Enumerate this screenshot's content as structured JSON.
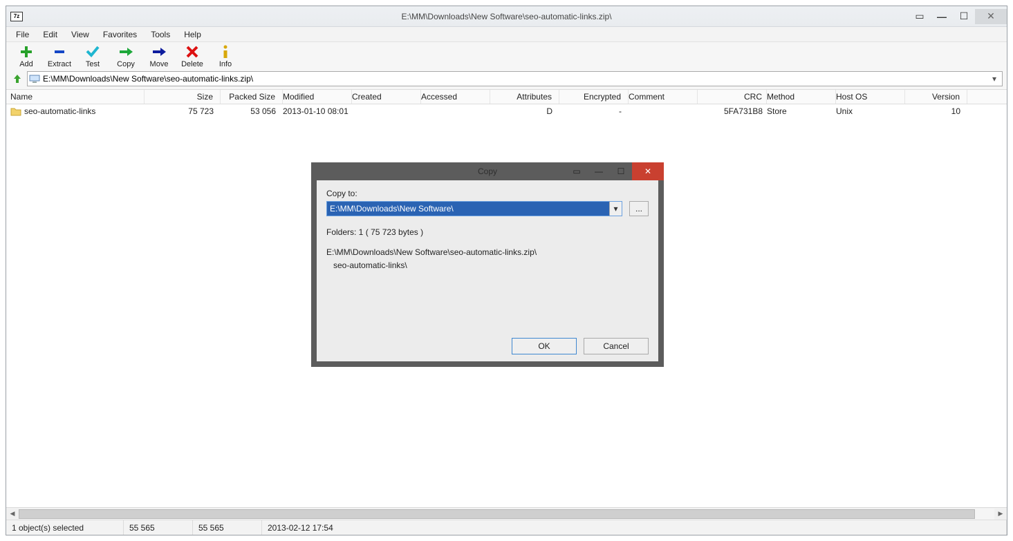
{
  "app_icon_label": "7z",
  "window_title": "E:\\MM\\Downloads\\New Software\\seo-automatic-links.zip\\",
  "menubar": [
    "File",
    "Edit",
    "View",
    "Favorites",
    "Tools",
    "Help"
  ],
  "toolbar": {
    "add": "Add",
    "extract": "Extract",
    "test": "Test",
    "copy": "Copy",
    "move": "Move",
    "delete": "Delete",
    "info": "Info"
  },
  "path": "E:\\MM\\Downloads\\New Software\\seo-automatic-links.zip\\",
  "columns": {
    "name": "Name",
    "size": "Size",
    "packed": "Packed Size",
    "modified": "Modified",
    "created": "Created",
    "accessed": "Accessed",
    "attributes": "Attributes",
    "encrypted": "Encrypted",
    "comment": "Comment",
    "crc": "CRC",
    "method": "Method",
    "host": "Host OS",
    "version": "Version"
  },
  "row": {
    "name": "seo-automatic-links",
    "size": "75 723",
    "packed": "53 056",
    "modified": "2013-01-10 08:01",
    "created": "",
    "accessed": "",
    "attributes": "D",
    "encrypted": "-",
    "comment": "",
    "crc": "5FA731B8",
    "method": "Store",
    "host": "Unix",
    "version": "10"
  },
  "status": {
    "selected": "1 object(s) selected",
    "s1": "55 565",
    "s2": "55 565",
    "date": "2013-02-12 17:54"
  },
  "dialog": {
    "title": "Copy",
    "copy_to_label": "Copy to:",
    "copy_to_value": "E:\\MM\\Downloads\\New Software\\",
    "browse": "...",
    "folders_line": "Folders: 1    ( 75 723 bytes )",
    "src_line": "E:\\MM\\Downloads\\New Software\\seo-automatic-links.zip\\",
    "item_line": "seo-automatic-links\\",
    "ok": "OK",
    "cancel": "Cancel"
  }
}
